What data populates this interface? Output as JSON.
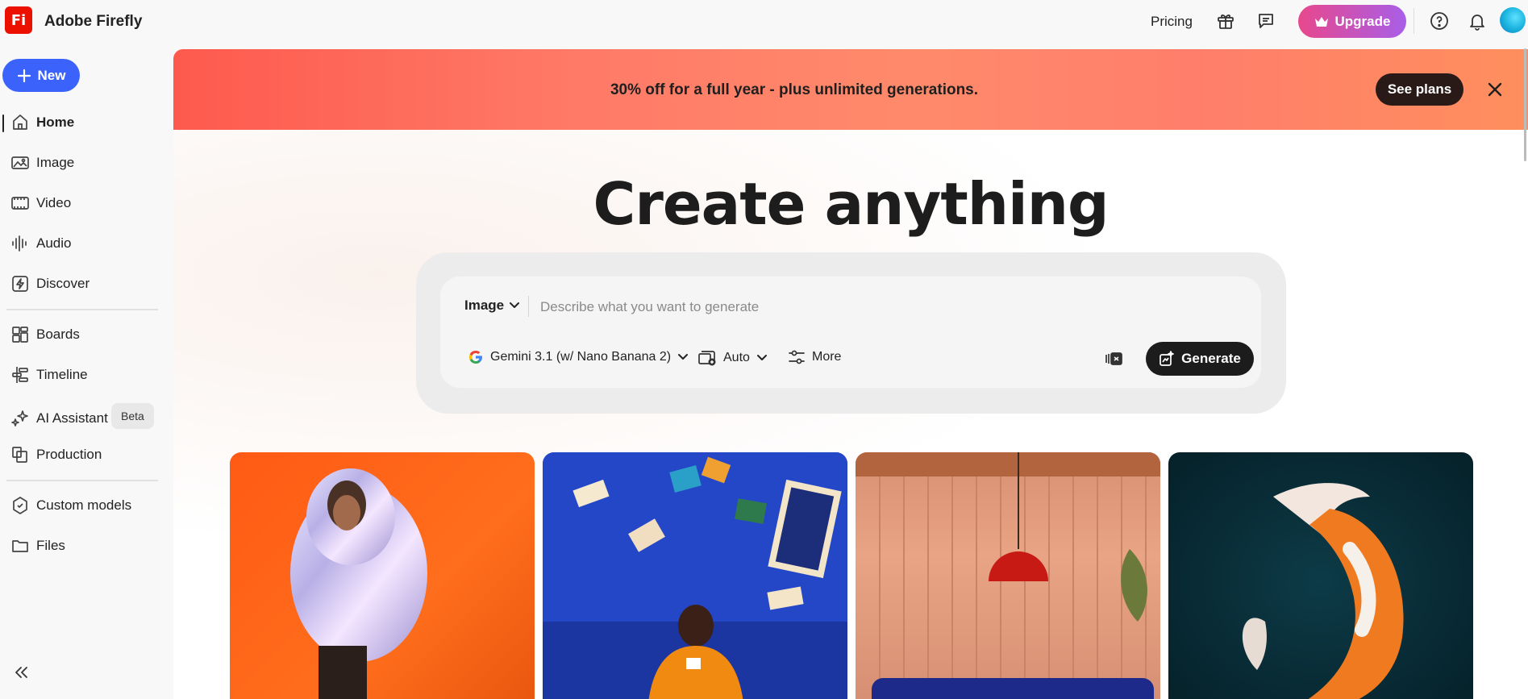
{
  "app": {
    "title": "Adobe Firefly",
    "logo_text": "Fi",
    "logo_color": "#eb1000"
  },
  "topbar": {
    "pricing": "Pricing",
    "upgrade": "Upgrade",
    "icons": [
      "gift-icon",
      "chat-icon",
      "help-icon",
      "bell-icon",
      "avatar"
    ]
  },
  "sidebar": {
    "new_label": "New",
    "items": [
      {
        "label": "Home",
        "icon": "home-icon",
        "active": true
      },
      {
        "label": "Image",
        "icon": "image-icon"
      },
      {
        "label": "Video",
        "icon": "video-icon"
      },
      {
        "label": "Audio",
        "icon": "audio-icon"
      },
      {
        "label": "Discover",
        "icon": "discover-icon"
      },
      {
        "label": "Boards",
        "icon": "boards-icon"
      },
      {
        "label": "Timeline",
        "icon": "timeline-icon"
      },
      {
        "label": "AI Assistant",
        "icon": "sparkle-icon",
        "badge": "Beta"
      },
      {
        "label": "Production",
        "icon": "production-icon"
      },
      {
        "label": "Custom models",
        "icon": "custom-models-icon"
      },
      {
        "label": "Files",
        "icon": "folder-icon"
      }
    ]
  },
  "promo": {
    "text": "30% off for a full year - plus unlimited generations.",
    "cta": "See plans"
  },
  "hero": {
    "title": "Create anything"
  },
  "prompt": {
    "mode": "Image",
    "placeholder": "Describe what you want to generate",
    "model": "Gemini 3.1 (w/ Nano Banana 2)",
    "aspect": "Auto",
    "more": "More",
    "generate": "Generate"
  },
  "colors": {
    "accent_blue": "#3b63fb",
    "upgrade_gradient_start": "#e8488c",
    "upgrade_gradient_end": "#a85ee8",
    "promo_bg": "#ff7a67",
    "generate_bg": "#1c1c1c"
  }
}
